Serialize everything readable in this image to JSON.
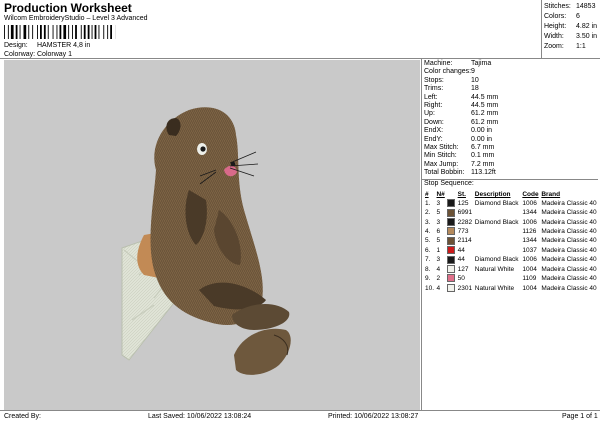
{
  "header": {
    "title": "Production Worksheet",
    "subtitle": "Wilcom EmbroideryStudio – Level 3 Advanced",
    "design_label": "Design:",
    "design_value": "HAMSTER 4,8 in",
    "colorway_label": "Colorway:",
    "colorway_value": "Colorway 1"
  },
  "stats": [
    {
      "label": "Stitches:",
      "value": "14853"
    },
    {
      "label": "Colors:",
      "value": "6"
    },
    {
      "label": "Height:",
      "value": "4.82 in"
    },
    {
      "label": "Width:",
      "value": "3.50 in"
    },
    {
      "label": "Zoom:",
      "value": "1:1"
    }
  ],
  "machine_info": [
    {
      "label": "Machine:",
      "value": "Tajima"
    },
    {
      "label": "Color changes:",
      "value": "9"
    },
    {
      "label": "Stops:",
      "value": "10"
    },
    {
      "label": "Trims:",
      "value": "18"
    },
    {
      "label": "Left:",
      "value": "44.5 mm"
    },
    {
      "label": "Right:",
      "value": "44.5 mm"
    },
    {
      "label": "Up:",
      "value": "61.2 mm"
    },
    {
      "label": "Down:",
      "value": "61.2 mm"
    },
    {
      "label": "EndX:",
      "value": "0.00 in"
    },
    {
      "label": "EndY:",
      "value": "0.00 in"
    },
    {
      "label": "Max Stitch:",
      "value": "6.7 mm"
    },
    {
      "label": "Min Stitch:",
      "value": "0.1 mm"
    },
    {
      "label": "Max Jump:",
      "value": "7.2 mm"
    },
    {
      "label": "Total Bobbin:",
      "value": "113.12ft"
    }
  ],
  "stop_sequence": {
    "heading": "Stop Sequence:",
    "columns": [
      "#",
      "N#",
      "",
      "St.",
      "Description",
      "Code",
      "Brand"
    ],
    "rows": [
      {
        "num": "1.",
        "n": "3",
        "color": "#1a1a1a",
        "st": "125",
        "desc": "Diamond Black",
        "code": "1006",
        "brand": "Madeira Classic 40"
      },
      {
        "num": "2.",
        "n": "5",
        "color": "#6b5236",
        "st": "6991",
        "desc": "",
        "code": "1344",
        "brand": "Madeira Classic 40"
      },
      {
        "num": "3.",
        "n": "3",
        "color": "#1a1a1a",
        "st": "2282",
        "desc": "Diamond Black",
        "code": "1006",
        "brand": "Madeira Classic 40"
      },
      {
        "num": "4.",
        "n": "6",
        "color": "#b58a5c",
        "st": "773",
        "desc": "",
        "code": "1126",
        "brand": "Madeira Classic 40"
      },
      {
        "num": "5.",
        "n": "5",
        "color": "#6b5236",
        "st": "2114",
        "desc": "",
        "code": "1344",
        "brand": "Madeira Classic 40"
      },
      {
        "num": "6.",
        "n": "1",
        "color": "#cc1a1a",
        "st": "44",
        "desc": "",
        "code": "1037",
        "brand": "Madeira Classic 40"
      },
      {
        "num": "7.",
        "n": "3",
        "color": "#1a1a1a",
        "st": "44",
        "desc": "Diamond Black",
        "code": "1006",
        "brand": "Madeira Classic 40"
      },
      {
        "num": "8.",
        "n": "4",
        "color": "#f2f2ec",
        "st": "127",
        "desc": "Natural White",
        "code": "1004",
        "brand": "Madeira Classic 40"
      },
      {
        "num": "9.",
        "n": "2",
        "color": "#e0708a",
        "st": "50",
        "desc": "",
        "code": "1109",
        "brand": "Madeira Classic 40"
      },
      {
        "num": "10.",
        "n": "4",
        "color": "#f2f2ec",
        "st": "2301",
        "desc": "Natural White",
        "code": "1004",
        "brand": "Madeira Classic 40"
      }
    ]
  },
  "footer": {
    "created_by": "Created By:",
    "last_saved": "Last Saved: 10/06/2022 13:08:24",
    "printed": "Printed: 10/06/2022 13:08:27",
    "page": "Page 1 of 1"
  },
  "colors": {
    "canvas_bg": "#c9c9c9",
    "fur_main": "#7d6344",
    "fur_dark": "#4a3a28",
    "fur_light": "#a88c66",
    "leaf": "#dfe3d6"
  }
}
